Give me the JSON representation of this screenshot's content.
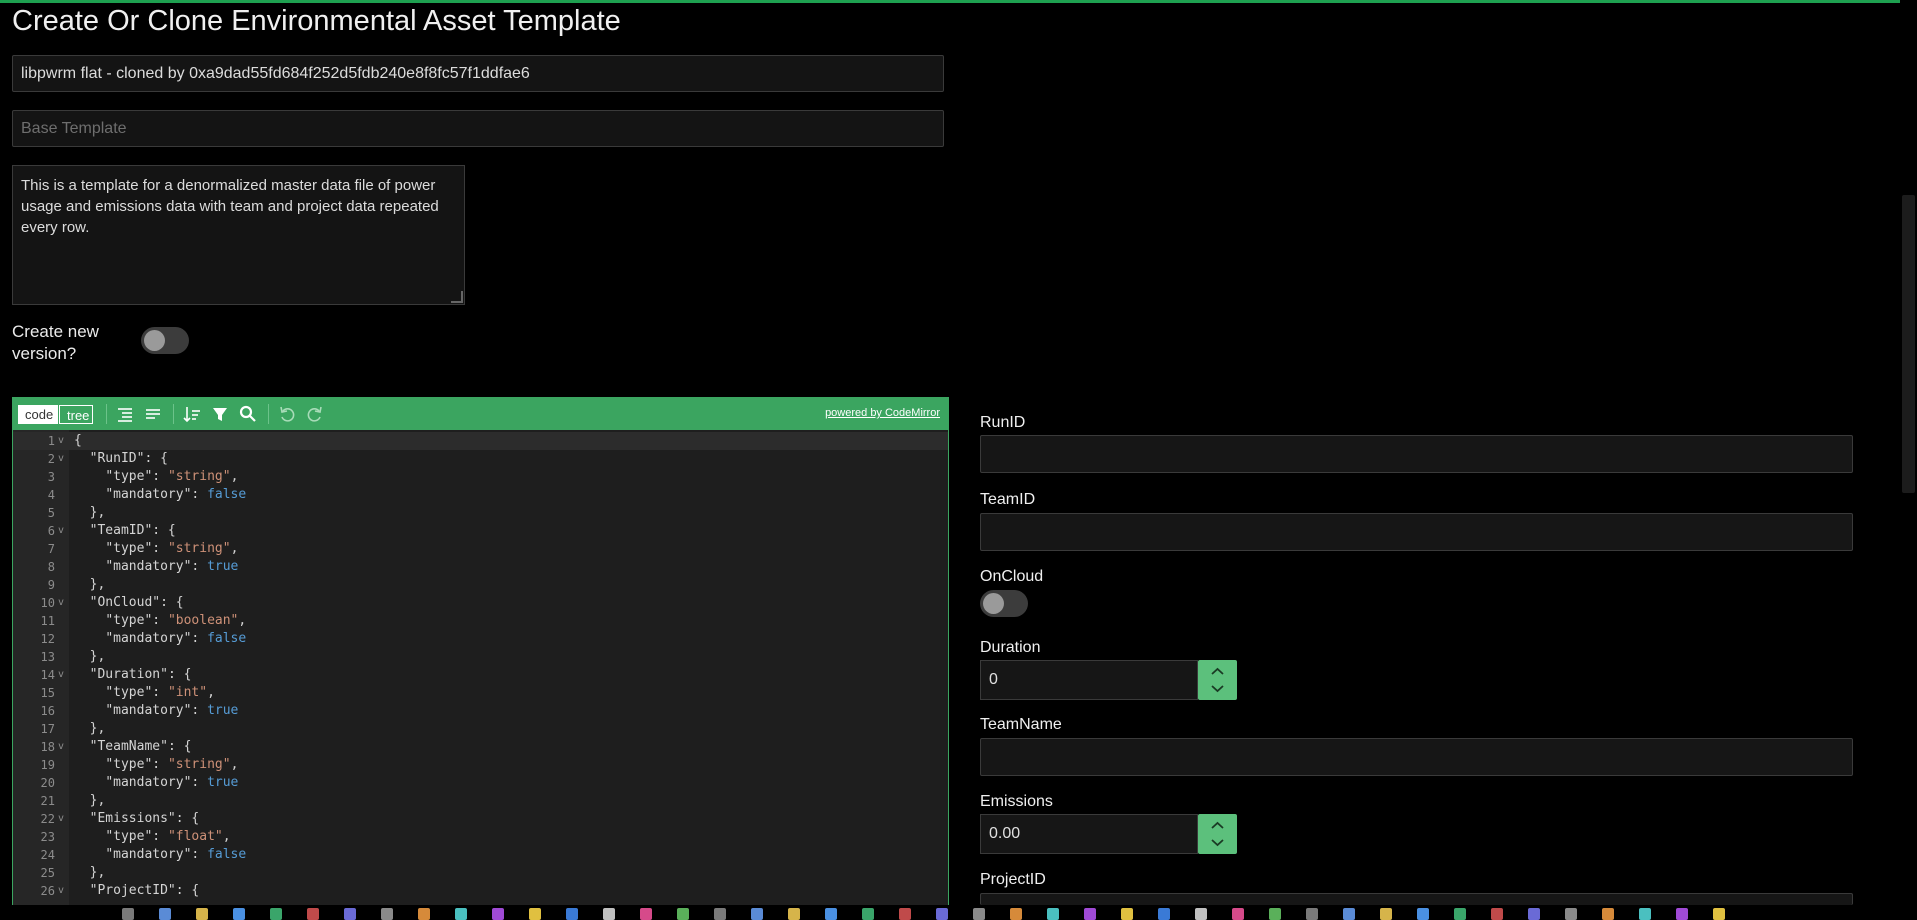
{
  "page": {
    "title": "Create Or Clone Environmental Asset Template",
    "name_value": "libpwrm flat - cloned by 0xa9dad55fd684f252d5fdb240e8f8fc57f1ddfae6",
    "base_template_placeholder": "Base Template",
    "description": "This is a template for a denormalized master data file of power usage and emissions data with team and project data repeated every row.",
    "create_new_version_label": "Create new version?",
    "create_new_version_on": false
  },
  "editor": {
    "mode_code": "code",
    "mode_tree": "tree",
    "powered_by": "powered by CodeMirror",
    "lines": [
      {
        "n": "1",
        "fold": "v",
        "parts": [
          [
            "p",
            "{"
          ]
        ]
      },
      {
        "n": "2",
        "fold": "v",
        "parts": [
          [
            "p",
            "  "
          ],
          [
            "k",
            "\"RunID\""
          ],
          [
            "p",
            ": {"
          ]
        ]
      },
      {
        "n": "3",
        "fold": "",
        "parts": [
          [
            "p",
            "    "
          ],
          [
            "k",
            "\"type\""
          ],
          [
            "p",
            ": "
          ],
          [
            "s",
            "\"string\""
          ],
          [
            "p",
            ","
          ]
        ]
      },
      {
        "n": "4",
        "fold": "",
        "parts": [
          [
            "p",
            "    "
          ],
          [
            "k",
            "\"mandatory\""
          ],
          [
            "p",
            ": "
          ],
          [
            "b",
            "false"
          ]
        ]
      },
      {
        "n": "5",
        "fold": "",
        "parts": [
          [
            "p",
            "  },"
          ]
        ]
      },
      {
        "n": "6",
        "fold": "v",
        "parts": [
          [
            "p",
            "  "
          ],
          [
            "k",
            "\"TeamID\""
          ],
          [
            "p",
            ": {"
          ]
        ]
      },
      {
        "n": "7",
        "fold": "",
        "parts": [
          [
            "p",
            "    "
          ],
          [
            "k",
            "\"type\""
          ],
          [
            "p",
            ": "
          ],
          [
            "s",
            "\"string\""
          ],
          [
            "p",
            ","
          ]
        ]
      },
      {
        "n": "8",
        "fold": "",
        "parts": [
          [
            "p",
            "    "
          ],
          [
            "k",
            "\"mandatory\""
          ],
          [
            "p",
            ": "
          ],
          [
            "b",
            "true"
          ]
        ]
      },
      {
        "n": "9",
        "fold": "",
        "parts": [
          [
            "p",
            "  },"
          ]
        ]
      },
      {
        "n": "10",
        "fold": "v",
        "parts": [
          [
            "p",
            "  "
          ],
          [
            "k",
            "\"OnCloud\""
          ],
          [
            "p",
            ": {"
          ]
        ]
      },
      {
        "n": "11",
        "fold": "",
        "parts": [
          [
            "p",
            "    "
          ],
          [
            "k",
            "\"type\""
          ],
          [
            "p",
            ": "
          ],
          [
            "s",
            "\"boolean\""
          ],
          [
            "p",
            ","
          ]
        ]
      },
      {
        "n": "12",
        "fold": "",
        "parts": [
          [
            "p",
            "    "
          ],
          [
            "k",
            "\"mandatory\""
          ],
          [
            "p",
            ": "
          ],
          [
            "b",
            "false"
          ]
        ]
      },
      {
        "n": "13",
        "fold": "",
        "parts": [
          [
            "p",
            "  },"
          ]
        ]
      },
      {
        "n": "14",
        "fold": "v",
        "parts": [
          [
            "p",
            "  "
          ],
          [
            "k",
            "\"Duration\""
          ],
          [
            "p",
            ": {"
          ]
        ]
      },
      {
        "n": "15",
        "fold": "",
        "parts": [
          [
            "p",
            "    "
          ],
          [
            "k",
            "\"type\""
          ],
          [
            "p",
            ": "
          ],
          [
            "s",
            "\"int\""
          ],
          [
            "p",
            ","
          ]
        ]
      },
      {
        "n": "16",
        "fold": "",
        "parts": [
          [
            "p",
            "    "
          ],
          [
            "k",
            "\"mandatory\""
          ],
          [
            "p",
            ": "
          ],
          [
            "b",
            "true"
          ]
        ]
      },
      {
        "n": "17",
        "fold": "",
        "parts": [
          [
            "p",
            "  },"
          ]
        ]
      },
      {
        "n": "18",
        "fold": "v",
        "parts": [
          [
            "p",
            "  "
          ],
          [
            "k",
            "\"TeamName\""
          ],
          [
            "p",
            ": {"
          ]
        ]
      },
      {
        "n": "19",
        "fold": "",
        "parts": [
          [
            "p",
            "    "
          ],
          [
            "k",
            "\"type\""
          ],
          [
            "p",
            ": "
          ],
          [
            "s",
            "\"string\""
          ],
          [
            "p",
            ","
          ]
        ]
      },
      {
        "n": "20",
        "fold": "",
        "parts": [
          [
            "p",
            "    "
          ],
          [
            "k",
            "\"mandatory\""
          ],
          [
            "p",
            ": "
          ],
          [
            "b",
            "true"
          ]
        ]
      },
      {
        "n": "21",
        "fold": "",
        "parts": [
          [
            "p",
            "  },"
          ]
        ]
      },
      {
        "n": "22",
        "fold": "v",
        "parts": [
          [
            "p",
            "  "
          ],
          [
            "k",
            "\"Emissions\""
          ],
          [
            "p",
            ": {"
          ]
        ]
      },
      {
        "n": "23",
        "fold": "",
        "parts": [
          [
            "p",
            "    "
          ],
          [
            "k",
            "\"type\""
          ],
          [
            "p",
            ": "
          ],
          [
            "s",
            "\"float\""
          ],
          [
            "p",
            ","
          ]
        ]
      },
      {
        "n": "24",
        "fold": "",
        "parts": [
          [
            "p",
            "    "
          ],
          [
            "k",
            "\"mandatory\""
          ],
          [
            "p",
            ": "
          ],
          [
            "b",
            "false"
          ]
        ]
      },
      {
        "n": "25",
        "fold": "",
        "parts": [
          [
            "p",
            "  },"
          ]
        ]
      },
      {
        "n": "26",
        "fold": "v",
        "parts": [
          [
            "p",
            "  "
          ],
          [
            "k",
            "\"ProjectID\""
          ],
          [
            "p",
            ": {"
          ]
        ]
      }
    ]
  },
  "form": {
    "runid_label": "RunID",
    "teamid_label": "TeamID",
    "oncloud_label": "OnCloud",
    "oncloud_on": false,
    "duration_label": "Duration",
    "duration_value": "0",
    "teamname_label": "TeamName",
    "emissions_label": "Emissions",
    "emissions_value": "0.00",
    "projectid_label": "ProjectID"
  },
  "colors": {
    "accent": "#3ba560",
    "background": "#000000",
    "string": "#ce9178",
    "keyword": "#569cd6"
  }
}
